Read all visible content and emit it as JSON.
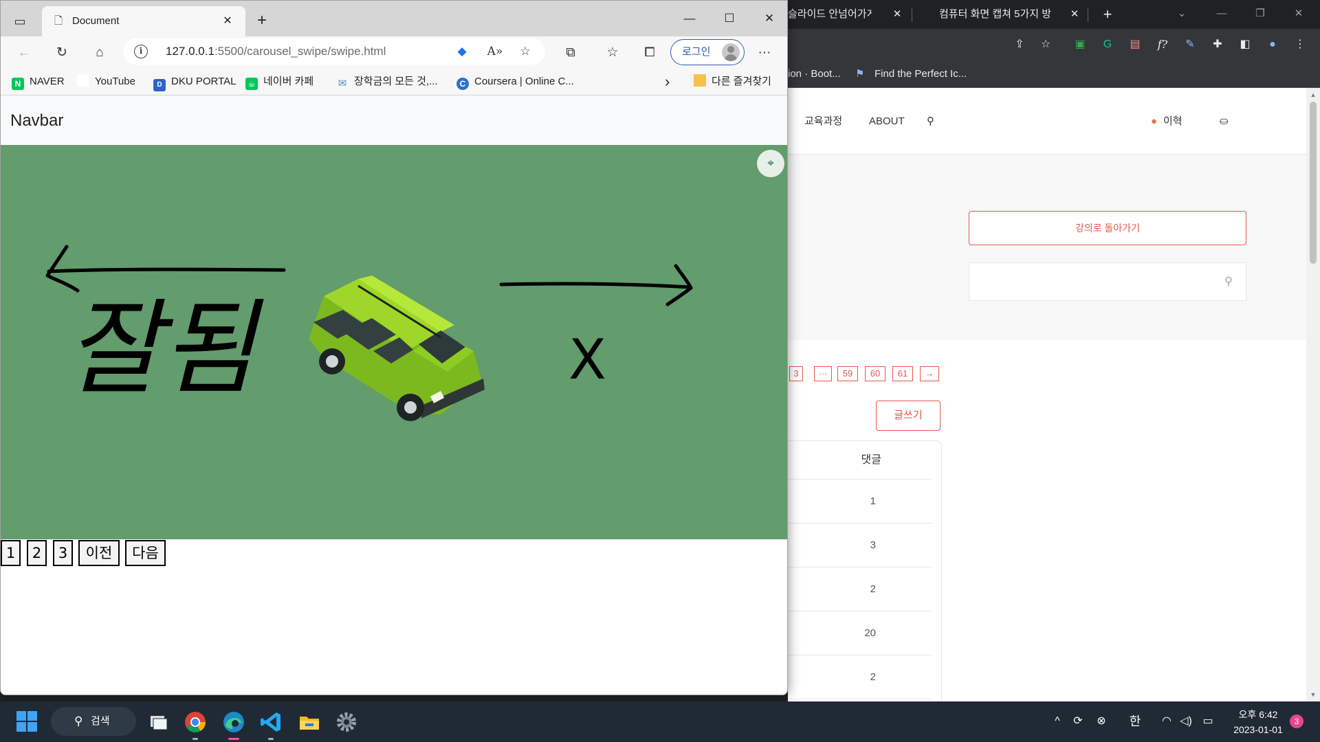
{
  "background_window": {
    "tabs": [
      {
        "title": "슬라이드 안넘어가게",
        "close": "✕"
      },
      {
        "title": "컴퓨터 화면 캡쳐 5가지 방",
        "close": "✕"
      }
    ],
    "new_tab": "+",
    "bookmarks": [
      {
        "label": "ion · Boot..."
      },
      {
        "label": "Find the Perfect Ic..."
      }
    ],
    "nav": {
      "curriculum": "교육과정",
      "about": "ABOUT",
      "user_name": "이혁"
    },
    "back_to_course": "강의로 돌아가기",
    "pager": [
      "3",
      "···",
      "59",
      "60",
      "61",
      "→"
    ],
    "write_button": "글쓰기",
    "table": {
      "header": "댓글",
      "rows": [
        "1",
        "3",
        "2",
        "20",
        "2"
      ]
    },
    "colors": {
      "accent": "#e5574a"
    }
  },
  "edge_window": {
    "tab": {
      "title": "Document",
      "close": "✕"
    },
    "new_tab": "+",
    "window_controls": {
      "minimize": "—",
      "maximize": "☐",
      "close": "✕"
    },
    "address": {
      "host": "127.0.0.1",
      "port": ":5500",
      "path": "/carousel_swipe/swipe.html"
    },
    "login_label": "로그인",
    "more": "···",
    "bookmarks": [
      {
        "label": "NAVER",
        "icon": "naver-icon",
        "icon_text": "N",
        "color": "#03c75a"
      },
      {
        "label": "YouTube",
        "icon": "youtube-icon",
        "icon_text": "",
        "color": "#ffffff"
      },
      {
        "label": "DKU PORTAL",
        "icon": "dku-icon",
        "icon_text": "D",
        "color": "#2f63c8"
      },
      {
        "label": "네이버 카페",
        "icon": "naver-cafe-icon",
        "icon_text": "☕",
        "color": "#03c75a"
      },
      {
        "label": "장학금의 모든 것,...",
        "icon": "scholarship-icon",
        "icon_text": "✉",
        "color": "#7aa6e0"
      },
      {
        "label": "Coursera | Online C...",
        "icon": "coursera-icon",
        "icon_text": "C",
        "color": "#2a73cc"
      }
    ],
    "bookmarks_overflow": "›",
    "other_bookmarks": "다른 즐겨찾기",
    "page": {
      "navbar_brand": "Navbar",
      "carousel_background": "#639c6d",
      "handwriting": "잘됨",
      "handwriting_x": "X",
      "controls": [
        "1",
        "2",
        "3",
        "이전",
        "다음"
      ]
    }
  },
  "taskbar": {
    "search_label": "검색",
    "ime": "한",
    "time": "오후 6:42",
    "date": "2023-01-01",
    "notification_count": "3"
  }
}
